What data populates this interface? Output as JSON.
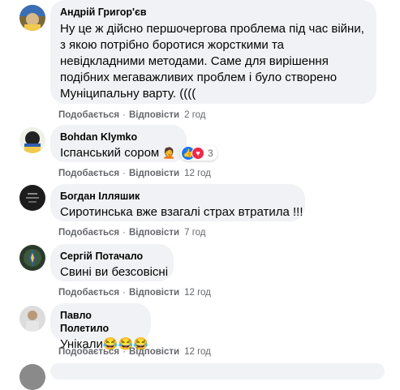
{
  "comments": [
    {
      "author": "Андрій Григор'єв",
      "lines": [
        "Ну це ж дійсно першочергова проблема під час війни,",
        "з якою потрібно боротися жорсткими та",
        "невідкладними методами. Саме для вирішення",
        "подібних мегаважливих проблем і було створено",
        "Муніципальну варту. (((("
      ],
      "like": "Подобається",
      "reply": "Відповісти",
      "time": "2 год"
    },
    {
      "author": "Bohdan Klymko",
      "text": "Іспанський сором",
      "emoji": "🤦",
      "reaction_count": "3",
      "like": "Подобається",
      "reply": "Відповісти",
      "time": "12 год"
    },
    {
      "author": "Богдан Ілляшик",
      "text": "Сиротинська вже взагалі страх втратила !!!",
      "like": "Подобається",
      "reply": "Відповісти",
      "time": "7 год"
    },
    {
      "author": "Сергій Потачало",
      "text": "Свині ви безсовісні",
      "like": "Подобається",
      "reply": "Відповісти",
      "time": "12 год"
    },
    {
      "author": "Павло Полетило",
      "text": "Унікали😂😂😂",
      "like": "Подобається",
      "reply": "Відповісти",
      "time": "12 год"
    }
  ],
  "colors": {
    "bubble": "#f0f2f5",
    "meta": "#65676b",
    "like": "#1877f2",
    "love": "#f02849"
  }
}
